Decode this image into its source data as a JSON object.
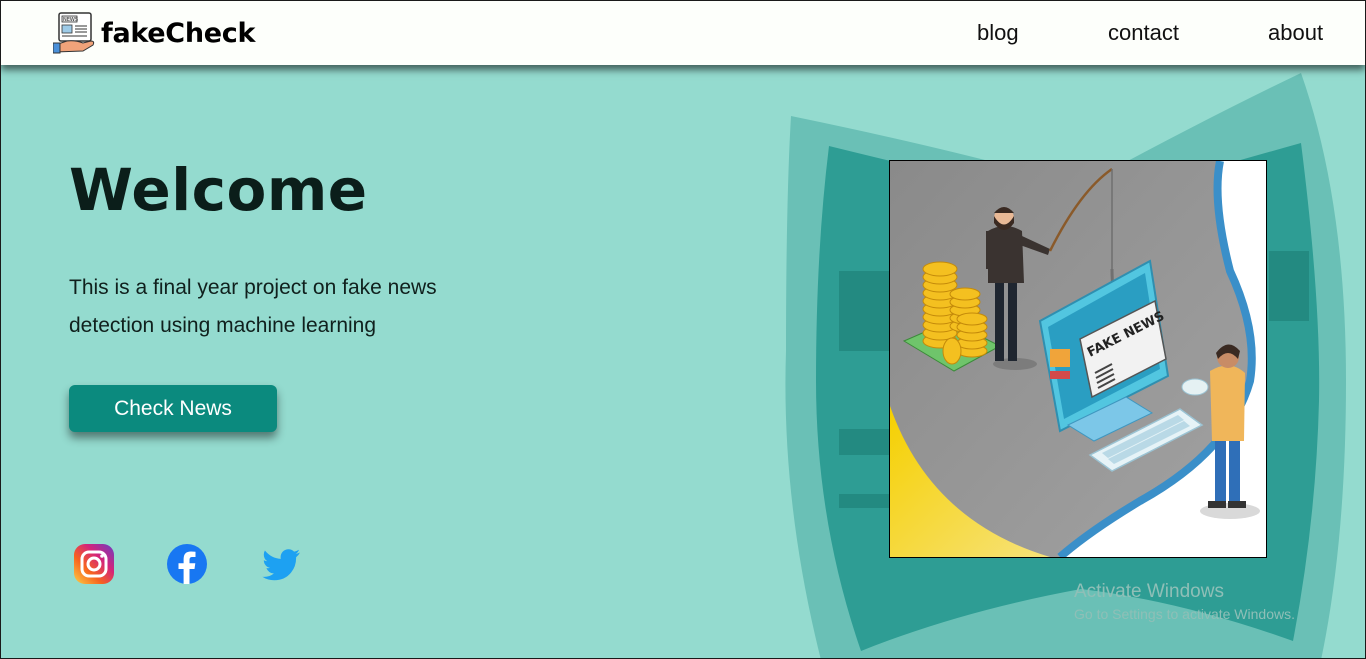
{
  "brand": {
    "name": "fakeCheck",
    "logo_icon": "news-hand-icon"
  },
  "nav": {
    "blog": "blog",
    "contact": "contact",
    "about": "about"
  },
  "hero": {
    "title": "Welcome",
    "subtitle": "This is a final year project on fake news detection using machine learning",
    "button_label": "Check News"
  },
  "social": [
    {
      "icon": "instagram-icon"
    },
    {
      "icon": "facebook-icon"
    },
    {
      "icon": "twitter-icon"
    }
  ],
  "illustration": {
    "sign_text": "FAKE NEWS"
  },
  "watermark": {
    "title": "Activate Windows",
    "subtitle": "Go to Settings to activate Windows."
  },
  "colors": {
    "background": "#94dbcf",
    "button": "#0b8a7e",
    "header": "#fdfffb",
    "teal_dark": "#2e9d94"
  }
}
